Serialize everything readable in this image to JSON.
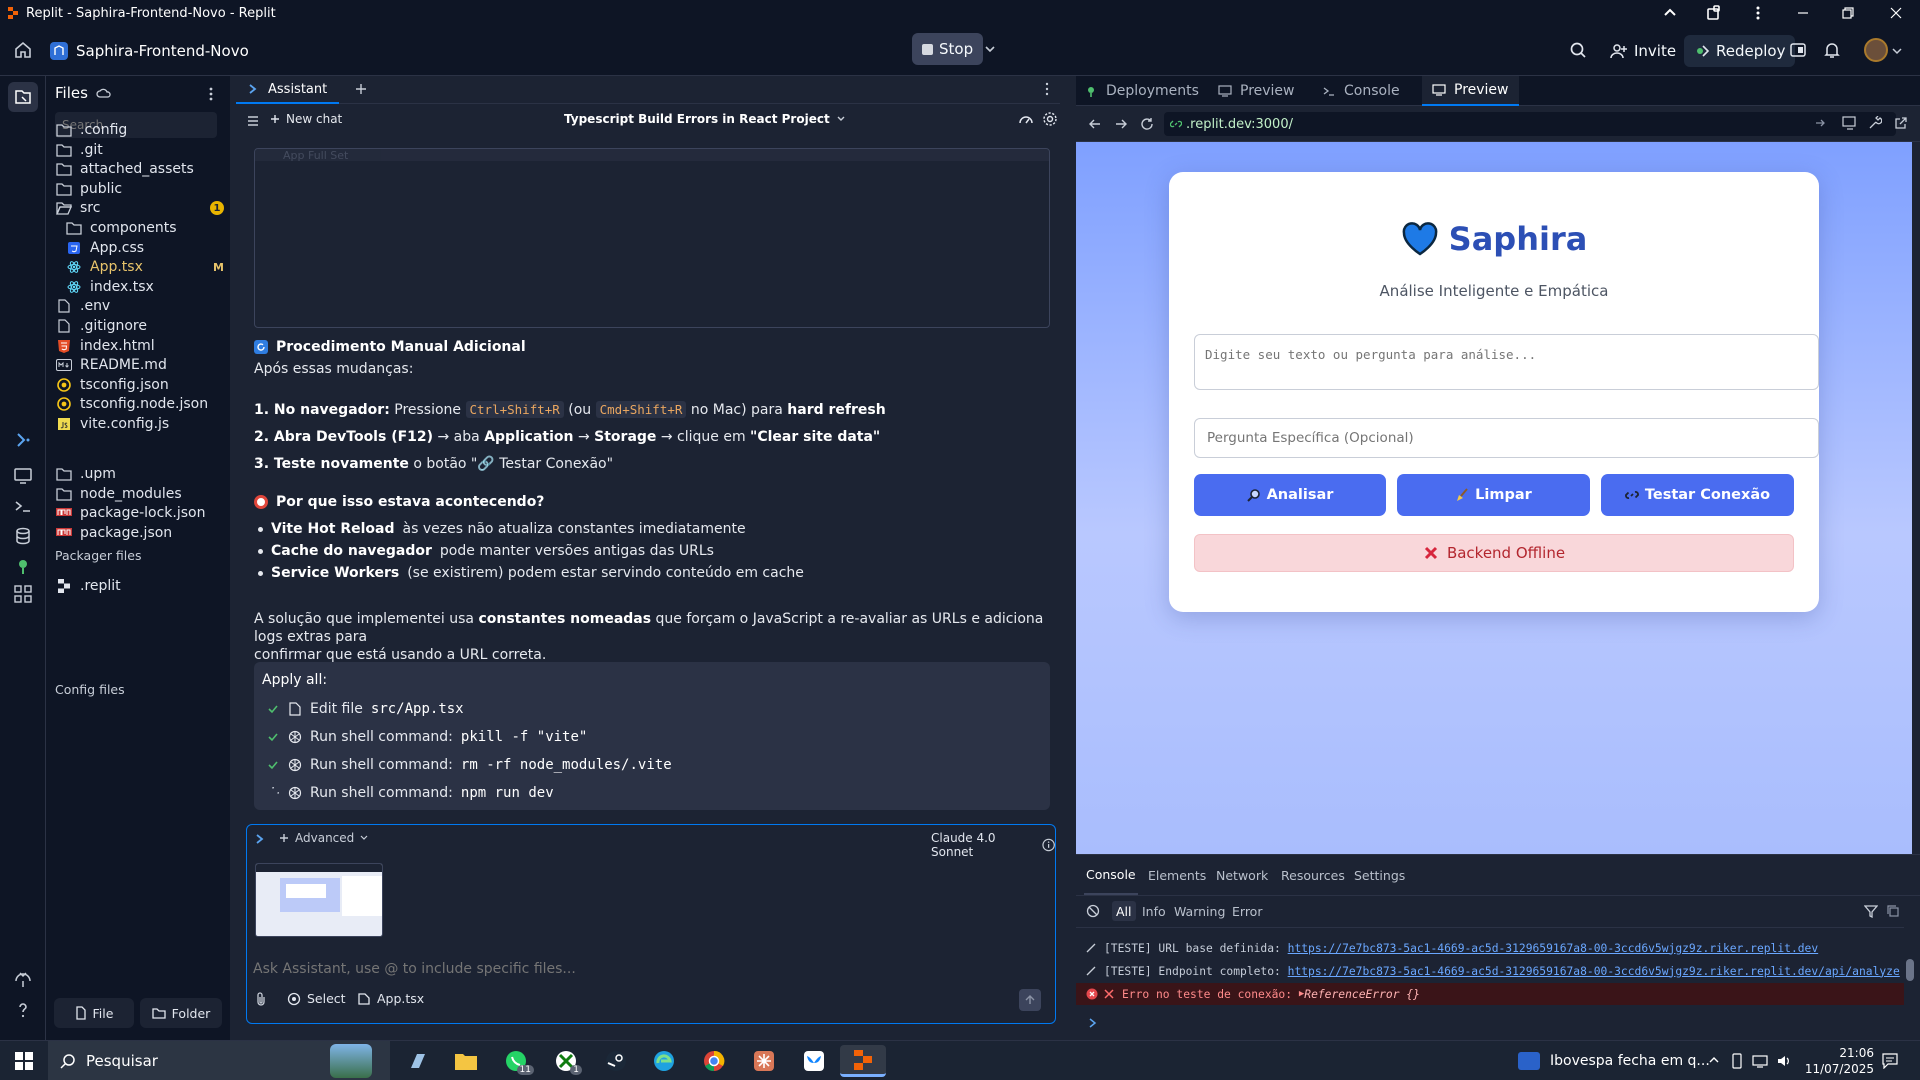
{
  "window": {
    "title": "Replit - Saphira-Frontend-Novo - Replit"
  },
  "topbar": {
    "project_name": "Saphira-Frontend-Novo",
    "stop_label": "Stop",
    "invite_label": "Invite",
    "redeploy_label": "Redeploy"
  },
  "files": {
    "title": "Files",
    "search_placeholder": "Search",
    "items": [
      {
        "name": ".config",
        "type": "folder"
      },
      {
        "name": ".git",
        "type": "folder"
      },
      {
        "name": "attached_assets",
        "type": "folder"
      },
      {
        "name": "public",
        "type": "folder"
      },
      {
        "name": "src",
        "type": "folder-open",
        "badge": "1"
      },
      {
        "name": "components",
        "type": "folder"
      },
      {
        "name": "App.css",
        "type": "css"
      },
      {
        "name": "App.tsx",
        "type": "react",
        "badge": "M"
      },
      {
        "name": "index.tsx",
        "type": "react"
      },
      {
        "name": ".env",
        "type": "file"
      },
      {
        "name": ".gitignore",
        "type": "file"
      },
      {
        "name": "index.html",
        "type": "html"
      },
      {
        "name": "README.md",
        "type": "md"
      },
      {
        "name": "tsconfig.json",
        "type": "json"
      },
      {
        "name": "tsconfig.node.json",
        "type": "json"
      },
      {
        "name": "vite.config.js",
        "type": "js"
      }
    ],
    "packager_title": "Packager files",
    "packager_items": [
      {
        "name": ".upm",
        "type": "folder"
      },
      {
        "name": "node_modules",
        "type": "folder"
      },
      {
        "name": "package-lock.json",
        "type": "npm"
      },
      {
        "name": "package.json",
        "type": "npm"
      }
    ],
    "config_title": "Config files",
    "config_items": [
      {
        "name": ".replit",
        "type": "replit"
      }
    ],
    "new_file_label": "File",
    "new_folder_label": "Folder"
  },
  "assistant": {
    "tab_label": "Assistant",
    "new_chat_label": "New chat",
    "chat_title": "Typescript Build Errors in React Project",
    "code_snippet_header": "App Full Set",
    "section1_title": "Procedimento Manual Adicional",
    "section1_intro": "Após essas mudanças:",
    "step1_prefix": "1. No navegador:",
    "step1_text": "Pressione",
    "step1_key1": "Ctrl+Shift+R",
    "step1_mid": "(ou",
    "step1_key2": "Cmd+Shift+R",
    "step1_suffix": "no Mac) para",
    "step1_bold": "hard refresh",
    "step2_prefix": "2. Abra DevTools (F12)",
    "step2_text1": "→ aba",
    "step2_b1": "Application",
    "step2_arrow": "→",
    "step2_b2": "Storage",
    "step2_text2": "→ clique em",
    "step2_b3": "\"Clear site data\"",
    "step3_prefix": "3. Teste novamente",
    "step3_text": "o botão \"🔗 Testar Conexão\"",
    "section2_title": "Por que isso estava acontecendo?",
    "bullets": [
      {
        "bold": "Vite Hot Reload",
        "text": "às vezes não atualiza constantes imediatamente"
      },
      {
        "bold": "Cache do navegador",
        "text": "pode manter versões antigas das URLs"
      },
      {
        "bold": "Service Workers",
        "text": "(se existirem) podem estar servindo conteúdo em cache"
      }
    ],
    "para_a": "A solução que implementei usa",
    "para_bold": "constantes nomeadas",
    "para_b": "que forçam o JavaScript a re-avaliar as URLs e adiciona logs extras para",
    "para_c": "confirmar que está usando a URL correta.",
    "apply_title": "Apply all:",
    "apply_items": [
      {
        "label": "Edit file",
        "code": "src/App.tsx",
        "status": "done"
      },
      {
        "label": "Run shell command:",
        "code": "pkill -f \"vite\"",
        "status": "done"
      },
      {
        "label": "Run shell command:",
        "code": "rm -rf node_modules/.vite",
        "status": "done"
      },
      {
        "label": "Run shell command:",
        "code": "npm run dev",
        "status": "running"
      }
    ],
    "composer": {
      "advanced_label": "Advanced",
      "model_label": "Claude 4.0 Sonnet",
      "placeholder": "Ask Assistant, use @ to include specific files...",
      "select_label": "Select",
      "file_label": "App.tsx"
    }
  },
  "right": {
    "tabs": [
      "Deployments",
      "Preview",
      "Console",
      "Preview"
    ],
    "url": ".replit.dev:3000/"
  },
  "app": {
    "name": "Saphira",
    "subtitle": "Análise Inteligente e Empática",
    "textarea_placeholder": "Digite seu texto ou pergunta para análise...",
    "question_placeholder": "Pergunta Específica (Opcional)",
    "btn_analyze": "Analisar",
    "btn_clear": "Limpar",
    "btn_test": "Testar Conexão",
    "status": "Backend Offline",
    "colors": {
      "brand": "#2c4fb5",
      "button": "#4a6cf0",
      "error_bg": "#f9d7da",
      "error_text": "#b3262e"
    }
  },
  "devtools": {
    "tabs": [
      "Console",
      "Elements",
      "Network",
      "Resources",
      "Settings"
    ],
    "filters": [
      "All",
      "Info",
      "Warning",
      "Error"
    ],
    "logs": [
      {
        "level": "log",
        "text": "[TESTE] URL base definida:",
        "link": "https://7e7bc873-5ac1-4669-ac5d-3129659167a8-00-3ccd6v5wjgz9z.riker.replit.dev"
      },
      {
        "level": "log",
        "text": "[TESTE] Endpoint completo:",
        "link": "https://7e7bc873-5ac1-4669-ac5d-3129659167a8-00-3ccd6v5wjgz9z.riker.replit.dev/api/analyze"
      },
      {
        "level": "error",
        "text": "Erro no teste de conexão:",
        "detail": "ReferenceError {}"
      }
    ]
  },
  "taskbar": {
    "search_placeholder": "Pesquisar",
    "news": "Ibovespa fecha em q...",
    "time": "21:06",
    "date": "11/07/2025",
    "badges": {
      "whatsapp": "11",
      "xbox": "1"
    }
  }
}
